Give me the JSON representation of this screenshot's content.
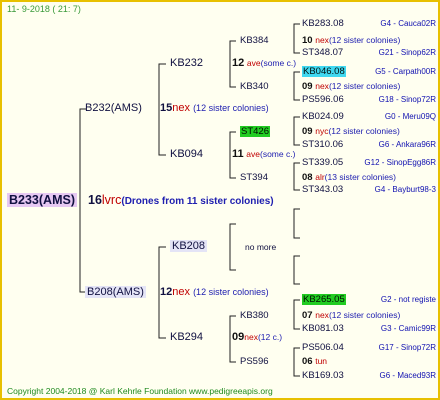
{
  "header": "11-   9-2018 (  21:   7)",
  "footer": "Copyright 2004-2018 @ Karl Kehrle Foundation    www.pedigreeapis.org",
  "root": {
    "name": "B233(AMS)",
    "gen": "16",
    "mark": "lvrc",
    "note": "(Drones from 11 sister colonies)"
  },
  "father": {
    "name": "B232(AMS)",
    "gen": "15",
    "mark": "nex",
    "note": "(12 sister colonies)"
  },
  "mother": {
    "name": "B208(AMS)",
    "gen": "12",
    "mark": "nex",
    "note": "(12 sister colonies)"
  },
  "kb232": {
    "name": "KB232",
    "gen": "12",
    "mark": "ave",
    "note": "(some c.)"
  },
  "kb094": {
    "name": "KB094",
    "gen": "11",
    "mark": "ave",
    "note": "(some c.)"
  },
  "kb208": {
    "name": "KB208",
    "more": "no more"
  },
  "kb294": {
    "name": "KB294",
    "gen": "09",
    "mark": "nex",
    "note": "(12 c.)"
  },
  "kb384": {
    "name": "KB384",
    "gen": "10",
    "mark": "nex",
    "note": "(12 sister colonies)"
  },
  "kb340": {
    "name": "KB340",
    "gen": "09",
    "mark": "nex",
    "note": "(12 sister colonies)"
  },
  "st426": {
    "name": "ST426",
    "gen": "09",
    "mark": "nyc",
    "note": "(12 sister colonies)"
  },
  "st394": {
    "name": "ST394",
    "gen": "08",
    "mark": "alr",
    "note": "(13 sister colonies)"
  },
  "kb380": {
    "name": "KB380",
    "gen": "07",
    "mark": "nex",
    "note": "(12 sister colonies)"
  },
  "ps596": {
    "name": "PS596",
    "gen": "06",
    "mark": "tun",
    "note": ""
  },
  "leaves": [
    {
      "id": "KB283.08",
      "info": "G4 - Cauca02R"
    },
    {
      "id": "ST348.07",
      "info": "G21 - Sinop62R"
    },
    {
      "id": "KB046.08",
      "info": "G5 - Carpath00R"
    },
    {
      "id": "PS596.06",
      "info": "G18 - Sinop72R"
    },
    {
      "id": "KB024.09",
      "info": "G0 - Meru09Q"
    },
    {
      "id": "ST310.06",
      "info": "G6 - Ankara96R"
    },
    {
      "id": "ST339.05",
      "info": "G12 - SinopEgg86R"
    },
    {
      "id": "ST343.03",
      "info": "G4 - Bayburt98-3"
    },
    {
      "id": "KB265.05",
      "info": "G2 - not registe"
    },
    {
      "id": "KB081.03",
      "info": "G3 - Camic99R"
    },
    {
      "id": "PS506.04",
      "info": "G17 - Sinop72R"
    },
    {
      "id": "KB169.03",
      "info": "G6 - Maced93R"
    }
  ],
  "colors": {
    "border": "#e8c000",
    "line": "#222222",
    "pink": "#e6c8f2",
    "green": "#22cc22",
    "cyan": "#40d8f0"
  }
}
